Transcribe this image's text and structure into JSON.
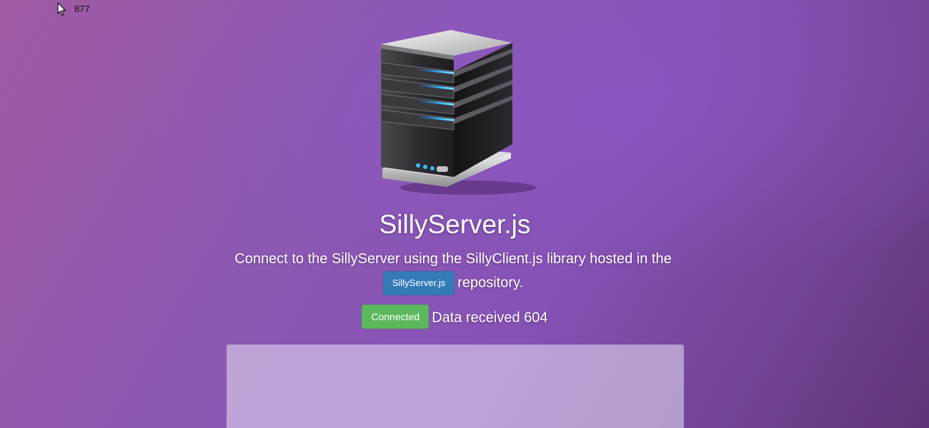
{
  "cursor": {
    "icon": "mouse-pointer-icon",
    "counter": "877"
  },
  "hero": {
    "icon": "server-icon",
    "title": "SillyServer.js",
    "description_prefix": "Connect to the SillyServer using the SillyClient.js library hosted in the",
    "repo_button": "SillyServer.js",
    "description_suffix": "repository."
  },
  "status": {
    "badge": "Connected",
    "data_label": "Data received 604"
  },
  "colors": {
    "primary": "#337ab7",
    "success": "#5cb85c",
    "background_start": "#a05aa2",
    "background_end": "#5e3478"
  }
}
